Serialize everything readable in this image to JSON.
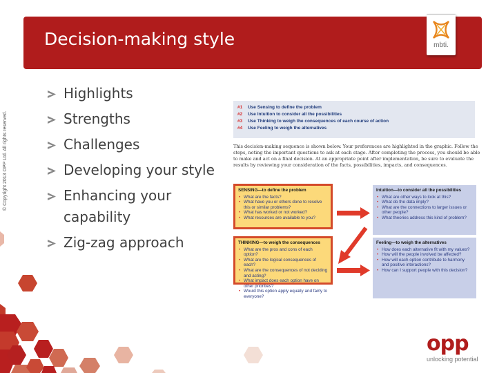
{
  "slide": {
    "title": "Decision-making style",
    "copyright": "© Copyright 2013 OPP Ltd. All rights reserved.",
    "brand_badge": "mbti.",
    "bullets": [
      "Highlights",
      "Strengths",
      "Challenges",
      "Developing your style",
      "Enhancing your capability",
      "Zig-zag approach"
    ],
    "colors": {
      "title_bar": "#b01c1c",
      "bullet_text": "#404040",
      "chevron": "#888888",
      "steps_bg": "#e3e7f0",
      "yellow_box": "#fcd97a",
      "yellow_border": "#d44a2a",
      "blue_box": "#c8cfe8",
      "arrow": "#e03a2a"
    }
  },
  "document": {
    "steps": [
      {
        "num": "#1",
        "text": "Use Sensing to define the problem"
      },
      {
        "num": "#2",
        "text": "Use Intuition to consider all the possibilities"
      },
      {
        "num": "#3",
        "text": "Use Thinking to weigh the consequences of each course of action"
      },
      {
        "num": "#4",
        "text": "Use Feeling to weigh the alternatives"
      }
    ],
    "intro": "This decision-making sequence is shown below. Your preferences are highlighted in the graphic. Follow the steps, noting the important questions to ask at each stage. After completing the process, you should be able to make and act on a final decision. At an appropriate point after implementation, be sure to evaluate the results by reviewing your consideration of the facts, possibilities, impacts, and consequences.",
    "sensing": {
      "heading": "SENSING—to define the problem",
      "items": [
        "What are the facts?",
        "What have you or others done to resolve this or similar problems?",
        "What has worked or not worked?",
        "What resources are available to you?"
      ]
    },
    "intuition": {
      "heading": "Intuition—to consider all the possibilities",
      "items": [
        "What are other ways to look at this?",
        "What do the data imply?",
        "What are the connections to larger issues or other people?",
        "What theories address this kind of problem?"
      ]
    },
    "thinking": {
      "heading": "THINKING—to weigh the consequences",
      "items": [
        "What are the pros and cons of each option?",
        "What are the logical consequences of each?",
        "What are the consequences of not deciding and acting?",
        "What impact does each option have on other priorities?",
        "Would this option apply equally and fairly to everyone?"
      ]
    },
    "feeling": {
      "heading": "Feeling—to weigh the alternatives",
      "items": [
        "How does each alternative fit with my values?",
        "How will the people involved be affected?",
        "How will each option contribute to harmony and positive interactions?",
        "How can I support people with this decision?"
      ]
    }
  },
  "footer": {
    "logo": "opp",
    "tagline": "unlocking potential"
  }
}
